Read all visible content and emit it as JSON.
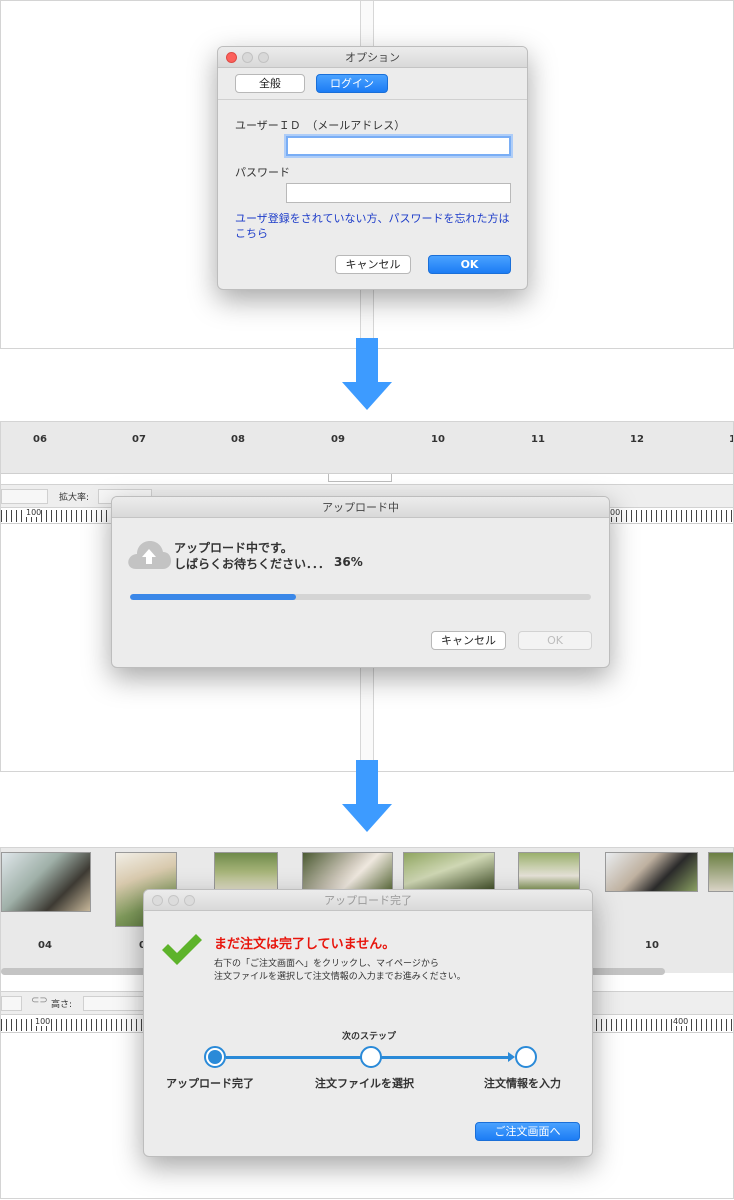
{
  "colors": {
    "accent_blue": "#1c7cf4",
    "progress_blue": "#3a87e8",
    "warning_red": "#e8150c",
    "check_green": "#5db32a",
    "step_blue": "#2a8ad8",
    "arrow_blue": "#3d9bff"
  },
  "options_dialog": {
    "title": "オプション",
    "tabs": [
      {
        "label": "全般"
      },
      {
        "label": "ログイン"
      }
    ],
    "userid_label": "ユーザーＩＤ　（メールアドレス）",
    "userid_value": "",
    "password_label": "パスワード",
    "password_value": "",
    "register_link": "ユーザ登録をされていない方、パスワードを忘れた方は",
    "register_link_2": "こちら",
    "cancel_label": "キャンセル",
    "ok_label": "OK"
  },
  "uploading_screen": {
    "timeline_labels": [
      "06",
      "07",
      "08",
      "09",
      "10",
      "11",
      "12",
      "1"
    ],
    "zoom_label": "拡大率:",
    "ruler_left_label": "100",
    "ruler_right_label": "00",
    "dialog": {
      "title": "アップロード中",
      "icon": "cloud-upload-icon",
      "message_line1": "アップロード中です。",
      "message_line2": "しばらくお待ちください．．．",
      "percent_label": "36%",
      "progress": 0.36,
      "cancel_label": "キャンセル",
      "ok_label": "OK"
    }
  },
  "complete_screen": {
    "timeline_labels": [
      "04",
      "0",
      "10"
    ],
    "height_label": "高さ:",
    "ruler_left_label": "100",
    "ruler_right_label": "400",
    "dialog": {
      "title": "アップロード完了",
      "icon": "checkmark-icon",
      "warning": "まだ注文は完了していません。",
      "desc_line1": "右下の「ご注文画面へ」をクリックし、マイページから",
      "desc_line2": "注文ファイルを選択して注文情報の入力までお進みください。",
      "next_step_label": "次のステップ",
      "steps": [
        {
          "label": "アップロード完了"
        },
        {
          "label": "注文ファイルを選択"
        },
        {
          "label": "注文情報を入力"
        }
      ],
      "order_button": "ご注文画面へ"
    }
  }
}
